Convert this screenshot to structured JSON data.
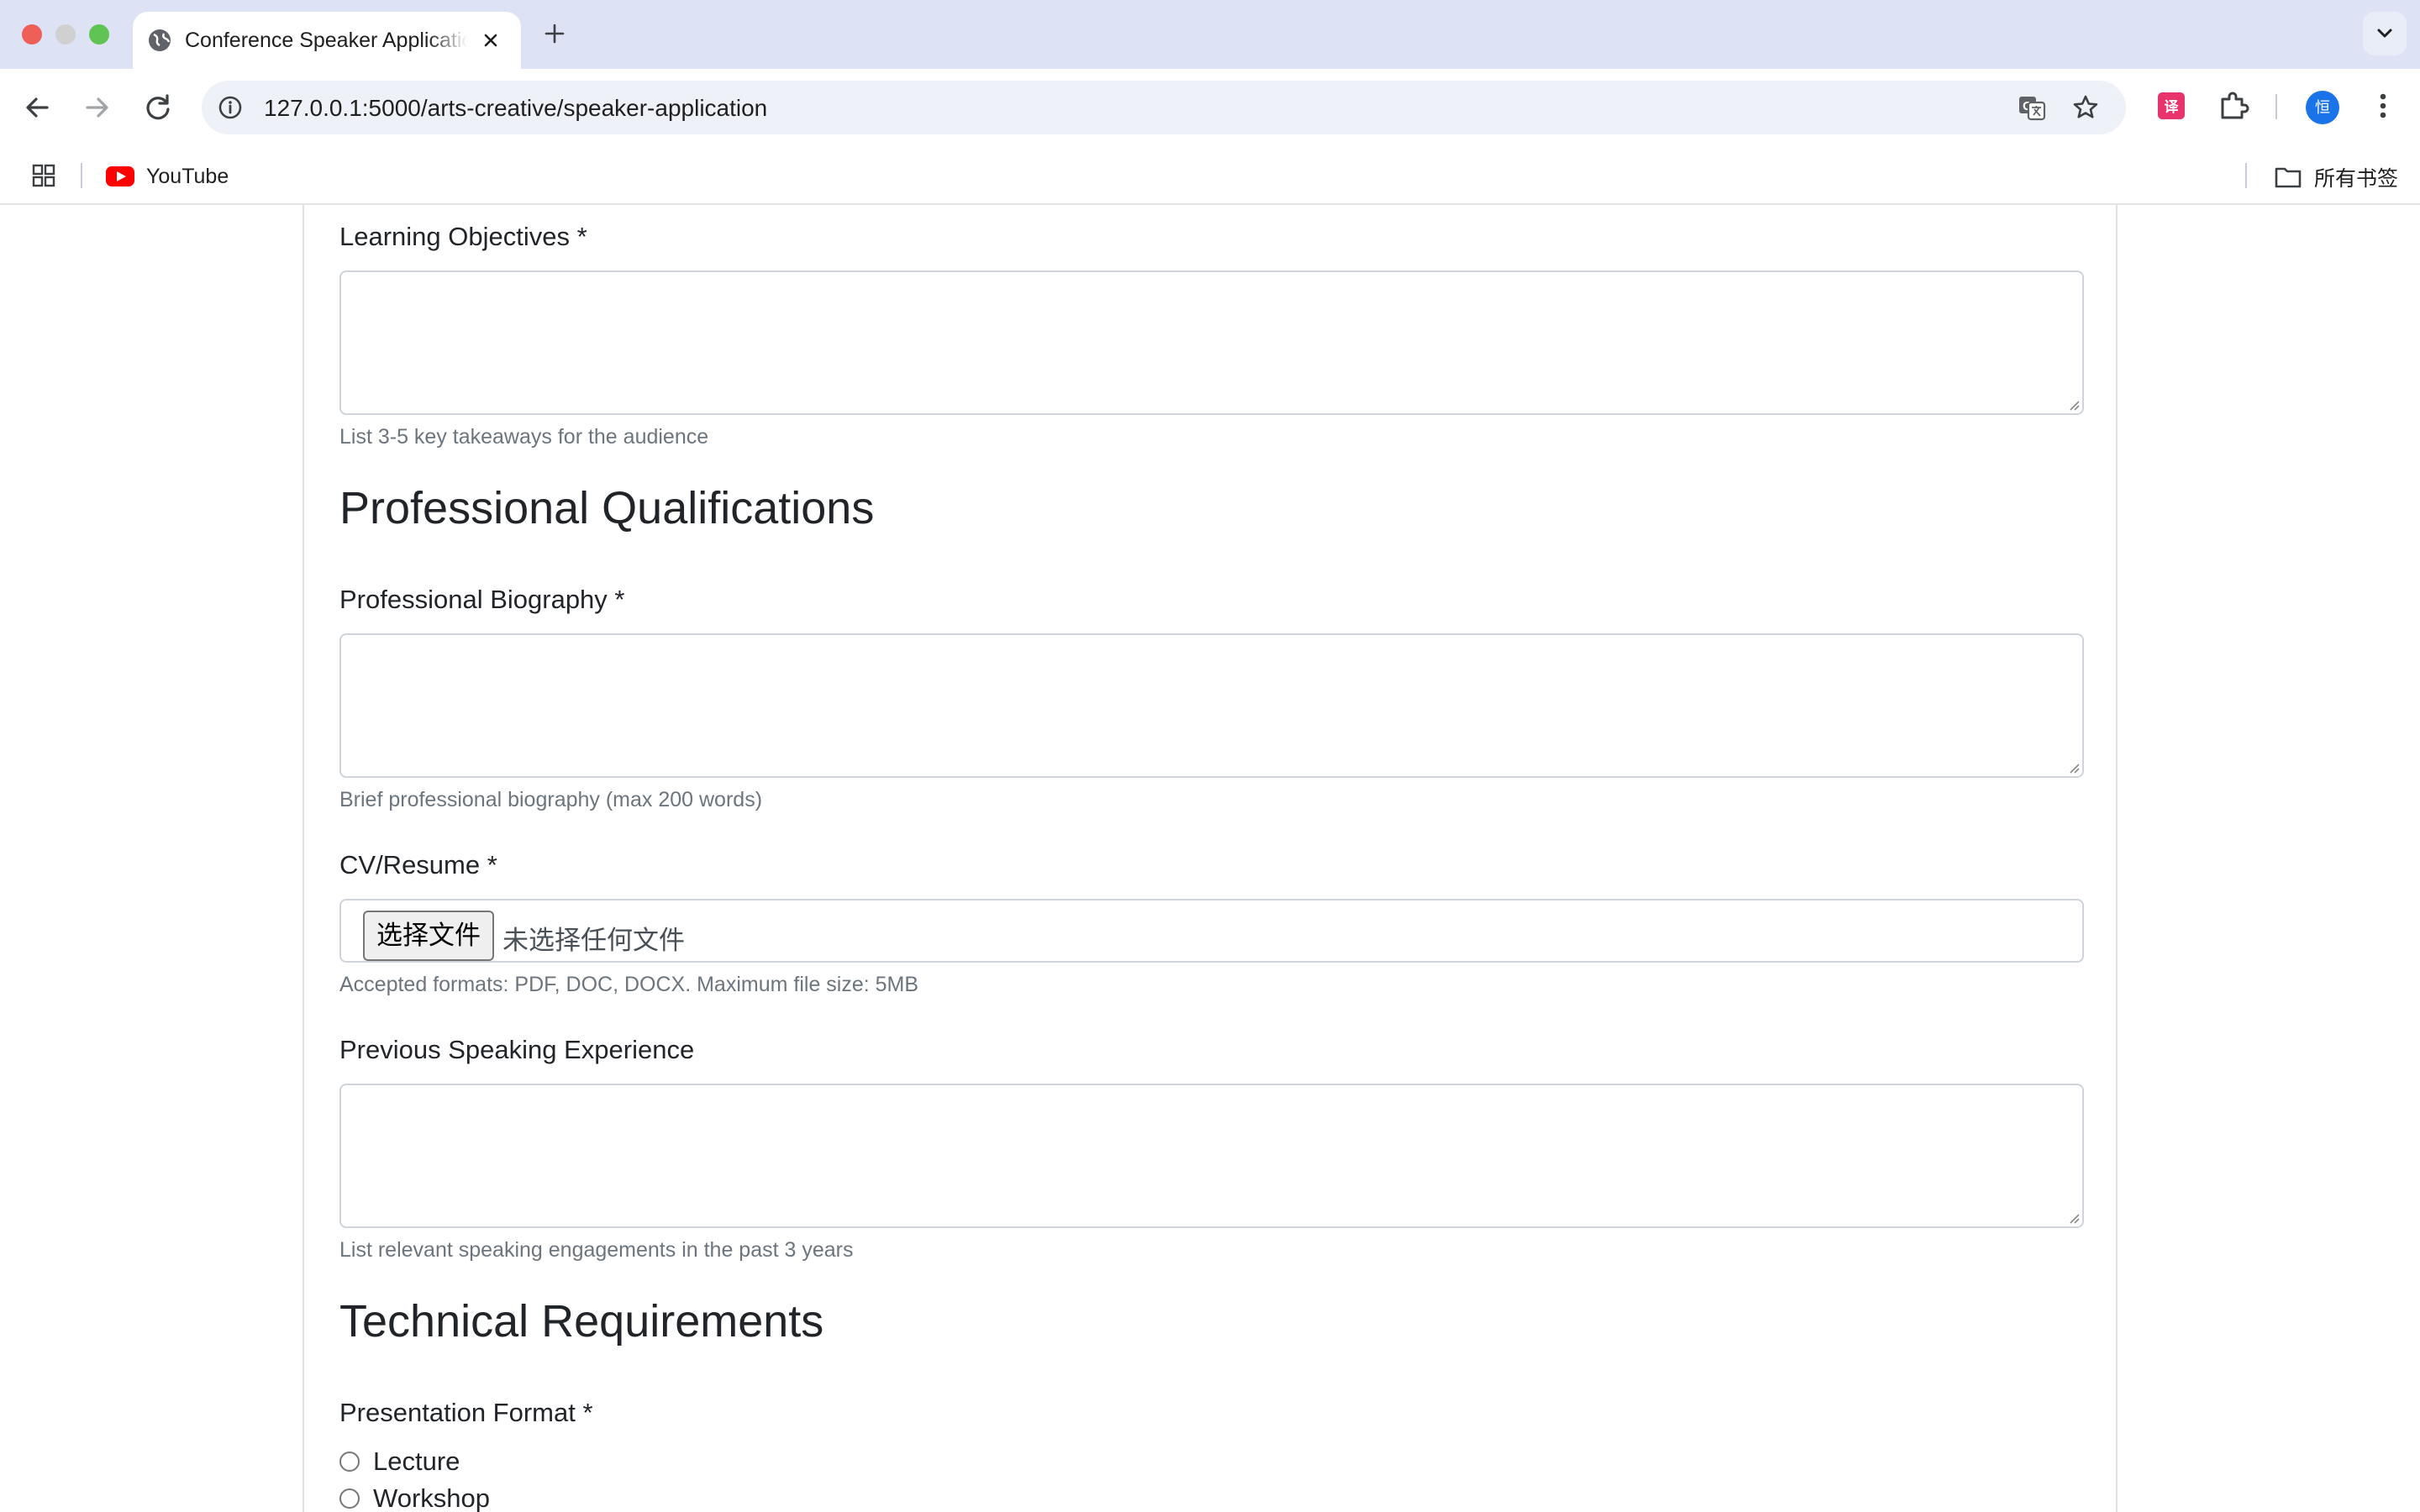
{
  "browser": {
    "tab_title": "Conference Speaker Application",
    "url": "127.0.0.1:5000/arts-creative/speaker-application",
    "avatar_letter": "恒",
    "bookmarks": [
      {
        "label": "YouTube"
      }
    ],
    "all_bookmarks_label": "所有书签"
  },
  "form": {
    "learning_objectives": {
      "label": "Learning Objectives *",
      "help": "List 3-5 key takeaways for the audience",
      "value": ""
    },
    "qualifications_heading": "Professional Qualifications",
    "biography": {
      "label": "Professional Biography *",
      "help": "Brief professional biography (max 200 words)",
      "value": ""
    },
    "cv": {
      "label": "CV/Resume *",
      "button_label": "选择文件",
      "status": "未选择任何文件",
      "help": "Accepted formats: PDF, DOC, DOCX. Maximum file size: 5MB"
    },
    "speaking_experience": {
      "label": "Previous Speaking Experience",
      "help": "List relevant speaking engagements in the past 3 years",
      "value": ""
    },
    "technical_heading": "Technical Requirements",
    "presentation_format": {
      "label": "Presentation Format *",
      "options": [
        {
          "label": "Lecture",
          "selected": false
        },
        {
          "label": "Workshop",
          "selected": false
        }
      ]
    }
  }
}
